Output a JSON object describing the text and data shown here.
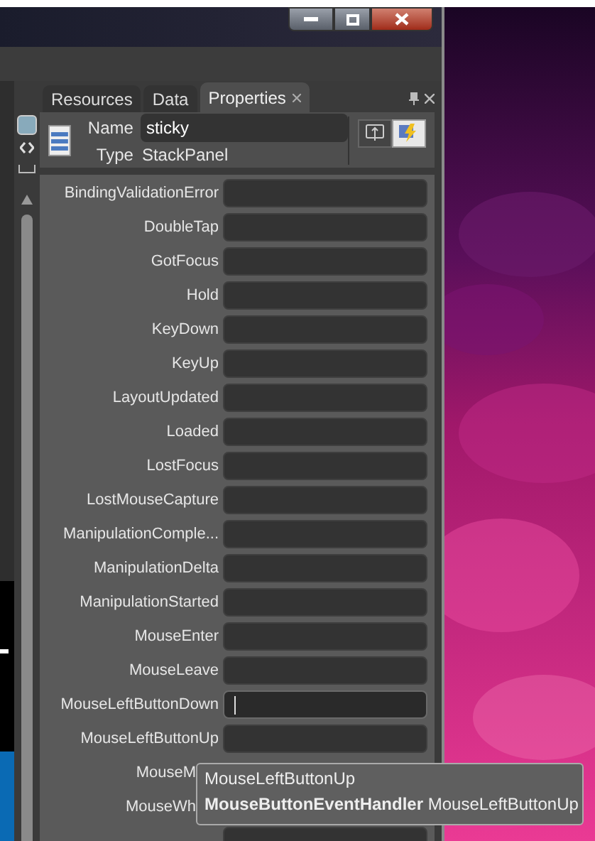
{
  "tabs": [
    {
      "label": "Resources",
      "selected": false
    },
    {
      "label": "Data",
      "selected": false
    },
    {
      "label": "Properties",
      "selected": true
    }
  ],
  "header": {
    "name_label": "Name",
    "name_value": "sticky",
    "type_label": "Type",
    "type_value": "StackPanel"
  },
  "view_buttons": [
    {
      "kind": "properties",
      "selected": false
    },
    {
      "kind": "events",
      "selected": true
    }
  ],
  "events": [
    {
      "label": "BindingValidationError",
      "focused": false
    },
    {
      "label": "DoubleTap",
      "focused": false
    },
    {
      "label": "GotFocus",
      "focused": false
    },
    {
      "label": "Hold",
      "focused": false
    },
    {
      "label": "KeyDown",
      "focused": false
    },
    {
      "label": "KeyUp",
      "focused": false
    },
    {
      "label": "LayoutUpdated",
      "focused": false
    },
    {
      "label": "Loaded",
      "focused": false
    },
    {
      "label": "LostFocus",
      "focused": false
    },
    {
      "label": "LostMouseCapture",
      "focused": false
    },
    {
      "label": "ManipulationComple...",
      "focused": false
    },
    {
      "label": "ManipulationDelta",
      "focused": false
    },
    {
      "label": "ManipulationStarted",
      "focused": false
    },
    {
      "label": "MouseEnter",
      "focused": false
    },
    {
      "label": "MouseLeave",
      "focused": false
    },
    {
      "label": "MouseLeftButtonDown",
      "focused": true
    },
    {
      "label": "MouseLeftButtonUp",
      "focused": false
    }
  ],
  "covered_events": [
    {
      "label": "MouseM"
    },
    {
      "label": "MouseWh"
    }
  ],
  "tooltip": {
    "title": "MouseLeftButtonUp",
    "signature": "**MouseButtonEventHandler** MouseLeftButtonUp"
  }
}
